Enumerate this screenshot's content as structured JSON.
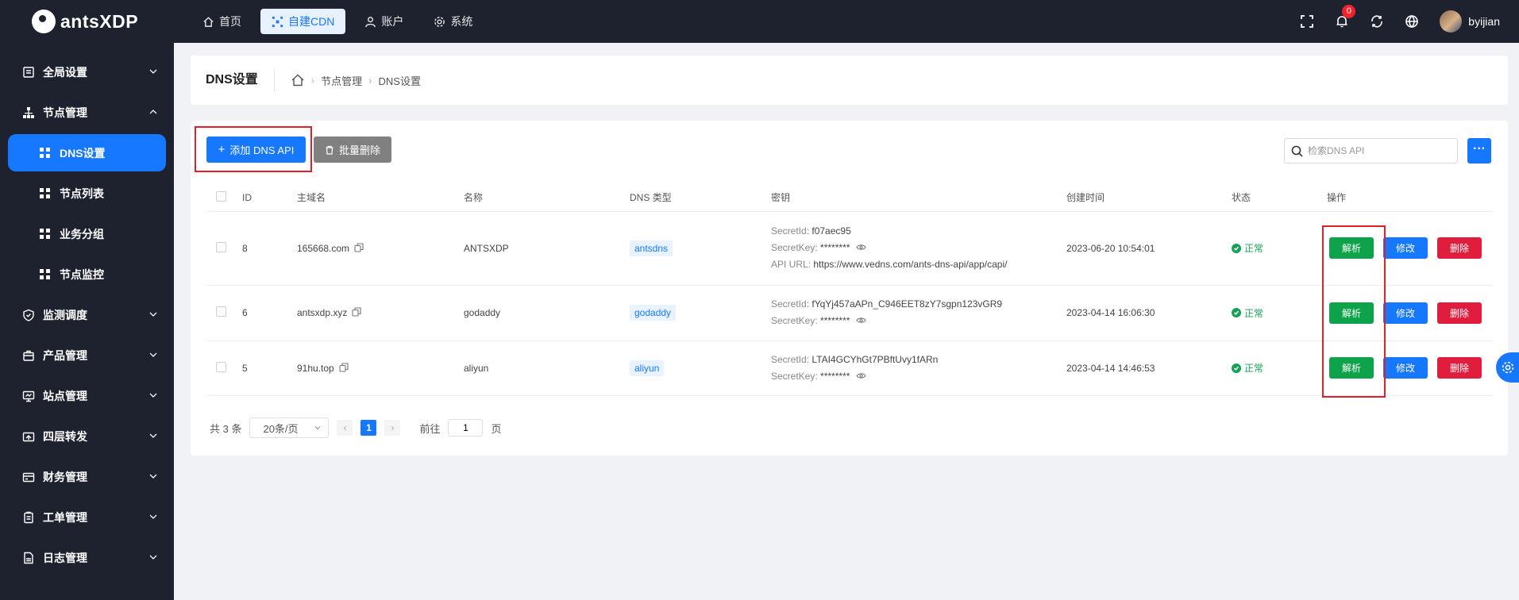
{
  "app": {
    "logo_text": "antsXDP"
  },
  "topnav": {
    "items": [
      {
        "label": "首页",
        "icon": "home-icon"
      },
      {
        "label": "自建CDN",
        "icon": "cdn-icon",
        "active": true
      },
      {
        "label": "账户",
        "icon": "user-icon"
      },
      {
        "label": "系统",
        "icon": "gear-icon"
      }
    ],
    "notification_count": "0",
    "username": "byijian"
  },
  "sidebar": {
    "items": [
      {
        "label": "全局设置"
      },
      {
        "label": "节点管理",
        "expanded": true
      },
      {
        "label": "DNS设置",
        "active": true
      },
      {
        "label": "节点列表"
      },
      {
        "label": "业务分组"
      },
      {
        "label": "节点监控"
      },
      {
        "label": "监测调度"
      },
      {
        "label": "产品管理"
      },
      {
        "label": "站点管理"
      },
      {
        "label": "四层转发"
      },
      {
        "label": "财务管理"
      },
      {
        "label": "工单管理"
      },
      {
        "label": "日志管理"
      }
    ]
  },
  "header": {
    "title": "DNS设置",
    "breadcrumb": [
      "节点管理",
      "DNS设置"
    ]
  },
  "toolbar": {
    "add_label": "添加 DNS API",
    "batch_delete_label": "批量删除",
    "search_placeholder": "检索DNS API",
    "more_label": "···"
  },
  "table": {
    "columns": [
      "ID",
      "主域名",
      "名称",
      "DNS 类型",
      "密钥",
      "创建时间",
      "状态",
      "操作"
    ],
    "rows": [
      {
        "id": "8",
        "domain": "165668.com",
        "name": "ANTSXDP",
        "dns_type": "antsdns",
        "secret_id_label": "SecretId:",
        "secret_id": "f07aec95",
        "secret_key_label": "SecretKey:",
        "secret_key": "********",
        "api_url_label": "API URL:",
        "api_url": "https://www.vedns.com/ants-dns-api/app/capi/",
        "created": "2023-06-20 10:54:01",
        "status": "正常"
      },
      {
        "id": "6",
        "domain": "antsxdp.xyz",
        "name": "godaddy",
        "dns_type": "godaddy",
        "secret_id_label": "SecretId:",
        "secret_id": "fYqYj457aAPn_C946EET8zY7sgpn123vGR9",
        "secret_key_label": "SecretKey:",
        "secret_key": "********",
        "created": "2023-04-14 16:06:30",
        "status": "正常"
      },
      {
        "id": "5",
        "domain": "91hu.top",
        "name": "aliyun",
        "dns_type": "aliyun",
        "secret_id_label": "SecretId:",
        "secret_id": "LTAI4GCYhGt7PBftUvy1fARn",
        "secret_key_label": "SecretKey:",
        "secret_key": "********",
        "created": "2023-04-14 14:46:53",
        "status": "正常"
      }
    ],
    "actions": {
      "parse": "解析",
      "edit": "修改",
      "delete": "删除"
    }
  },
  "pagination": {
    "total_text": "共 3 条",
    "page_size": "20条/页",
    "current_page": "1",
    "goto_prefix": "前往",
    "goto_value": "1",
    "goto_suffix": "页"
  },
  "colors": {
    "primary": "#1677ff",
    "sidebar_bg": "#1d222e",
    "success": "#0ea34a",
    "danger": "#e11d3e",
    "highlight": "#e0202a"
  }
}
